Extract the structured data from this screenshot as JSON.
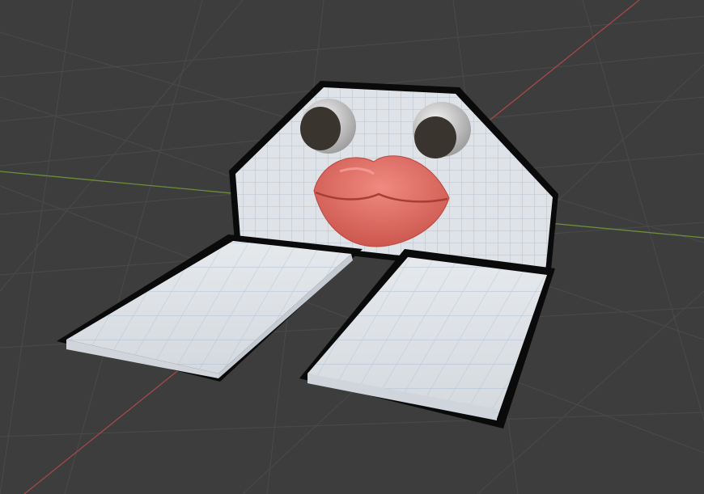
{
  "viewport": {
    "mode": "3d-viewport",
    "background_color": "#3d3d3d",
    "grid_color": "#4a4a4a",
    "x_axis_color": "#a54848",
    "y_axis_color": "#6e8d3c"
  },
  "object": {
    "panel_color": "#dfe3e8",
    "panel_grid_color": "#a9b8c8",
    "outline_color": "#0a0a0a",
    "lips_color": "#e8766c",
    "eye_white_color": "#e6e6e6",
    "pupil_color": "#3a342e"
  },
  "status": {
    "text": ""
  }
}
